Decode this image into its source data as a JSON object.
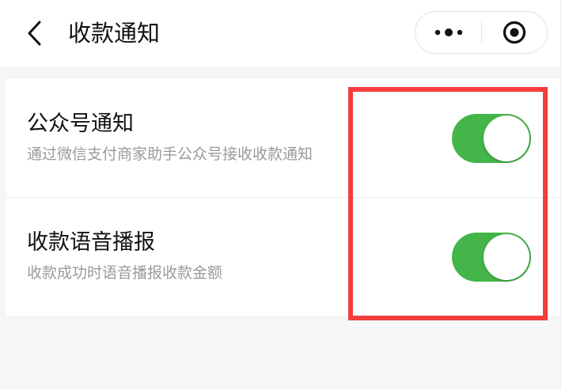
{
  "nav": {
    "title": "收款通知",
    "back_icon": "chevron-left-icon",
    "more_icon": "more-dots-icon",
    "close_icon": "target-circle-icon"
  },
  "settings": {
    "items": [
      {
        "title": "公众号通知",
        "description": "通过微信支付商家助手公众号接收收款通知",
        "enabled": true
      },
      {
        "title": "收款语音播报",
        "description": "收款成功时语音播报收款金额",
        "enabled": true
      }
    ]
  },
  "colors": {
    "switch_on": "#44b549",
    "highlight": "#f43d3d",
    "background": "#f6f6f6"
  }
}
